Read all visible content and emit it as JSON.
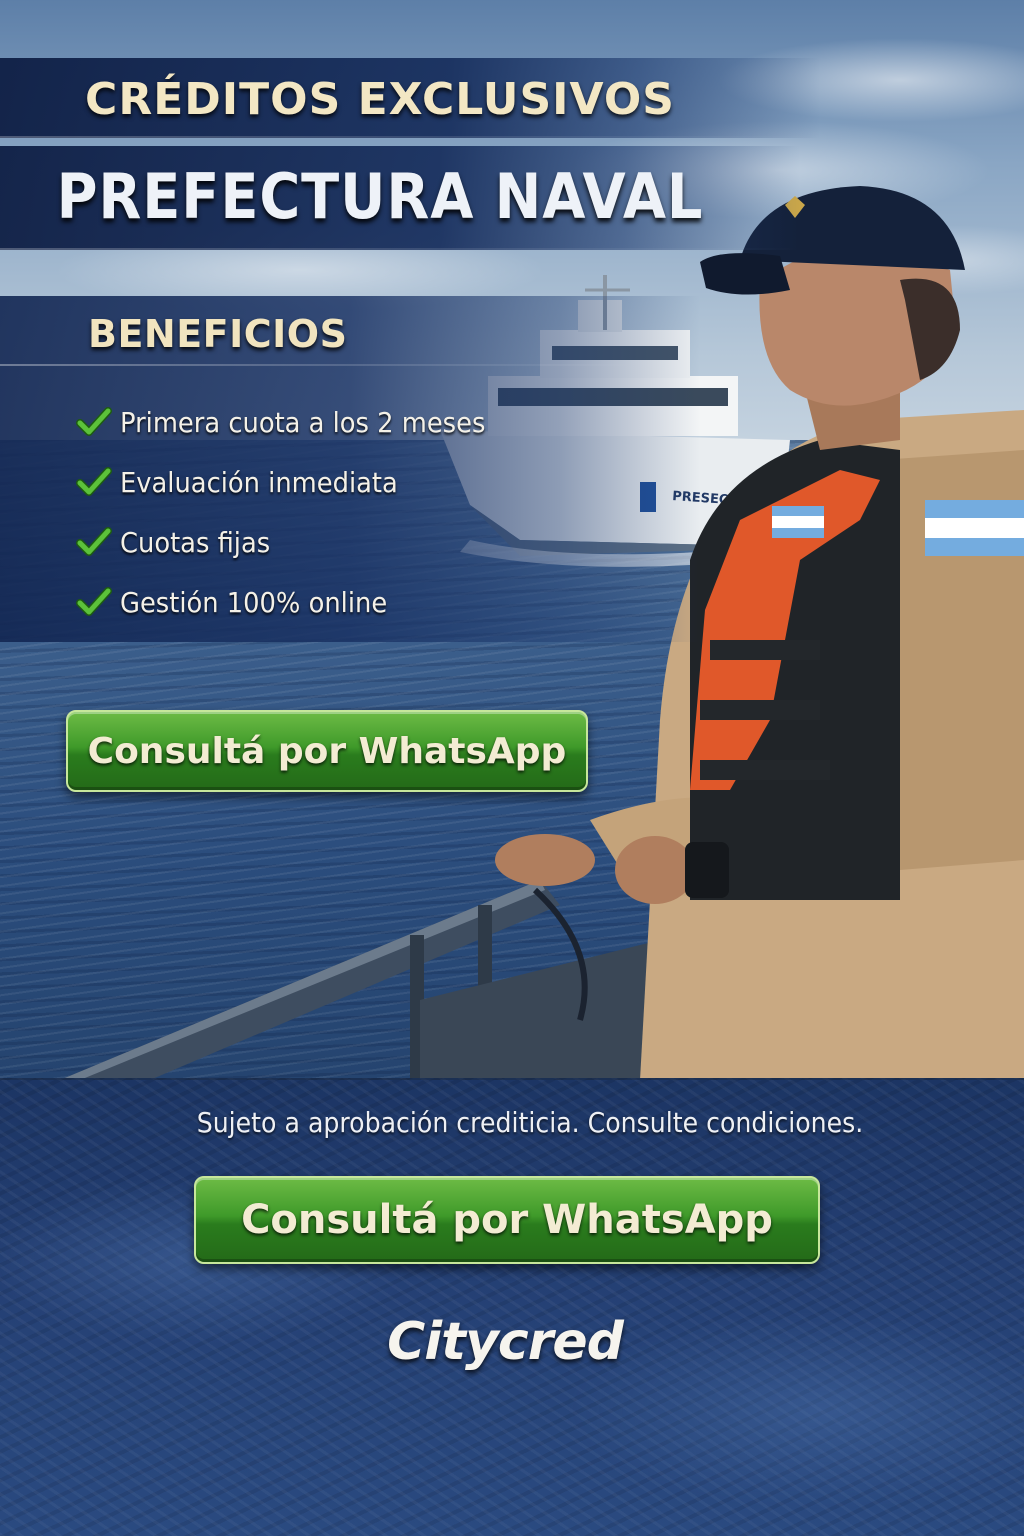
{
  "header": {
    "title_line_1": "CRÉDITOS EXCLUSIVOS",
    "title_line_2": "PREFECTURA NAVAL"
  },
  "benefits": {
    "title": "BENEFICIOS",
    "items": [
      {
        "label": "Primera cuota a los 2 meses",
        "icon": "check-icon"
      },
      {
        "label": "Evaluación inmediata",
        "icon": "check-icon"
      },
      {
        "label": "Cuotas fijas",
        "icon": "check-icon"
      },
      {
        "label": "Gestión 100% online",
        "icon": "check-icon"
      }
    ]
  },
  "cta_primary": {
    "label": "Consultá por WhatsApp"
  },
  "photo": {
    "vessel_hull_text": "PRESECTRURA"
  },
  "footer": {
    "disclaimer": "Sujeto a aprobación crediticia. Consulte condiciones.",
    "cta_secondary": {
      "label": "Consultá por WhatsApp"
    },
    "brand": "Citycred"
  },
  "colors": {
    "navy": "#1c3564",
    "button_green": "#3f9a2a",
    "check_green": "#5cc23a",
    "title_cream": "#f3e7c4",
    "vest_orange": "#e0582a",
    "uniform_khaki": "#c7a77e"
  }
}
